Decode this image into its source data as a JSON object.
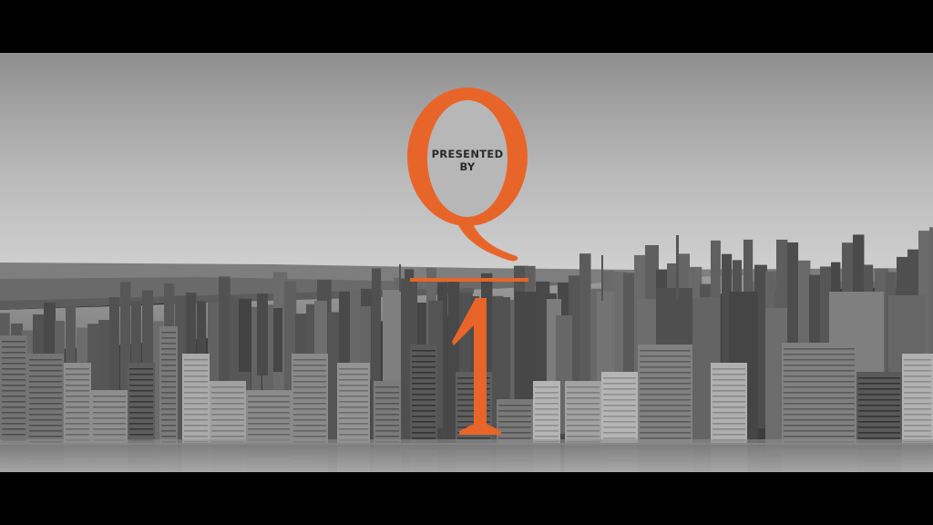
{
  "title_card": {
    "line1": "PRESENTED",
    "line2": "BY",
    "logo_letter": "Q",
    "logo_number": "1"
  },
  "colors": {
    "accent": "#E8652A",
    "sky_top": "#9a9a9a",
    "sky_horizon": "#c6c6c6",
    "text_dark": "#2a2a2a",
    "letterbox": "#000000"
  },
  "scene": {
    "description_icon": "city-skyline-icon"
  }
}
